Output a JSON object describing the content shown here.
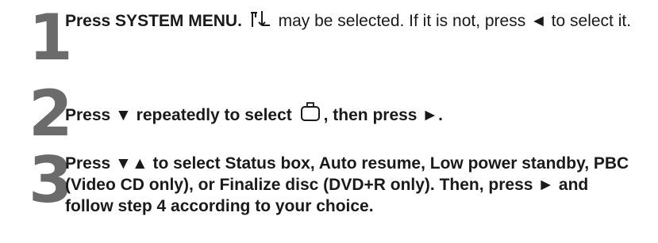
{
  "steps": [
    {
      "number": "1",
      "action": "Press SYSTEM MENU.",
      "icon": "setup-arrows-icon",
      "note": "may be selected. If it is not, press ◄ to select it."
    },
    {
      "number": "2",
      "before": "Press ▼ repeatedly to select",
      "icon": "disc-tray-icon",
      "after": ", then press ►."
    },
    {
      "number": "3",
      "action": "Press ▼▲ to select Status box, Auto resume, Low power standby, PBC (Video CD only), or Finalize disc (DVD+R only). Then, press ► and follow step 4 according to your choice."
    }
  ]
}
